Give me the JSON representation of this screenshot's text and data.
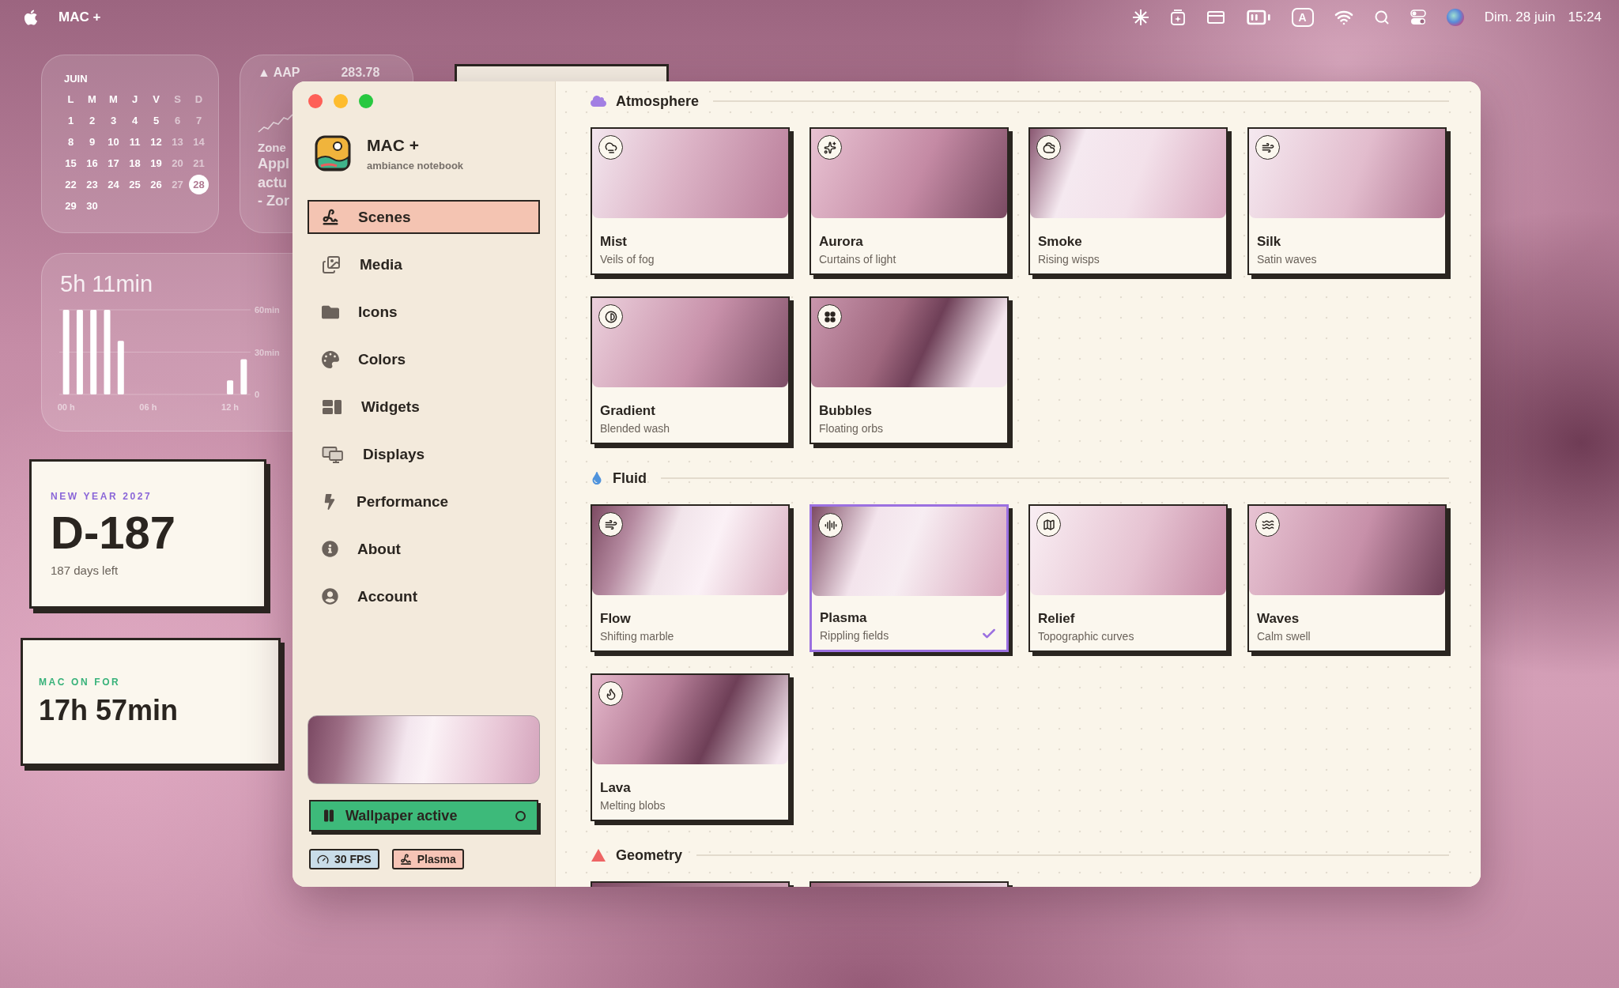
{
  "menu_bar": {
    "app_name": "MAC +",
    "input_source": "A",
    "date": "Dim. 28 juin",
    "time": "15:24"
  },
  "desktop": {
    "calendar": {
      "month": "JUIN",
      "weekdays": [
        "L",
        "M",
        "M",
        "J",
        "V",
        "S",
        "D"
      ],
      "days": [
        {
          "label": "1",
          "selected": false
        },
        {
          "label": "2",
          "selected": false
        },
        {
          "label": "3",
          "selected": false
        },
        {
          "label": "4",
          "selected": false
        },
        {
          "label": "5",
          "selected": false
        },
        {
          "label": "6",
          "selected": false
        },
        {
          "label": "7",
          "selected": false
        },
        {
          "label": "8",
          "selected": false
        },
        {
          "label": "9",
          "selected": false
        },
        {
          "label": "10",
          "selected": false
        },
        {
          "label": "11",
          "selected": false
        },
        {
          "label": "12",
          "selected": false
        },
        {
          "label": "13",
          "selected": false
        },
        {
          "label": "14",
          "selected": false
        },
        {
          "label": "15",
          "selected": false
        },
        {
          "label": "16",
          "selected": false
        },
        {
          "label": "17",
          "selected": false
        },
        {
          "label": "18",
          "selected": false
        },
        {
          "label": "19",
          "selected": false
        },
        {
          "label": "20",
          "selected": false
        },
        {
          "label": "21",
          "selected": false
        },
        {
          "label": "22",
          "selected": false
        },
        {
          "label": "23",
          "selected": false
        },
        {
          "label": "24",
          "selected": false
        },
        {
          "label": "25",
          "selected": false
        },
        {
          "label": "26",
          "selected": false
        },
        {
          "label": "27",
          "selected": false
        },
        {
          "label": "28",
          "selected": true
        },
        {
          "label": "29",
          "selected": false
        },
        {
          "label": "30",
          "selected": false
        }
      ]
    },
    "stocks": {
      "symbol": "▲ AAP",
      "price": "283.78",
      "lines": [
        "Zone",
        "Appl",
        "actu",
        "- Zor"
      ]
    },
    "screen_time": {
      "total": "5h 11min",
      "chart_data": {
        "type": "bar",
        "x": [
          0,
          1,
          2,
          3,
          4,
          5,
          6,
          7,
          8,
          9,
          10,
          11,
          12,
          13
        ],
        "values": [
          60,
          60,
          60,
          60,
          38,
          0,
          0,
          0,
          0,
          0,
          0,
          0,
          10,
          25
        ],
        "xlim": [
          -0.5,
          13.5
        ],
        "ylim": [
          0,
          60
        ],
        "xticks": [
          {
            "value": 0,
            "label": "00 h"
          },
          {
            "value": 6,
            "label": "06 h"
          },
          {
            "value": 12,
            "label": "12 h"
          }
        ],
        "yticks": [
          {
            "value": 0,
            "label": "0"
          },
          {
            "value": 30,
            "label": "30min"
          },
          {
            "value": 60,
            "label": "60min"
          }
        ]
      }
    },
    "countdown": {
      "label": "NEW YEAR 2027",
      "value": "D-187",
      "caption": "187 days left"
    },
    "uptime": {
      "label": "MAC ON FOR",
      "value": "17h 57min"
    }
  },
  "window": {
    "sidebar": {
      "app_name": "MAC +",
      "tagline": "ambiance notebook",
      "nav": [
        {
          "label": "Scenes",
          "selected": true
        },
        {
          "label": "Media",
          "selected": false
        },
        {
          "label": "Icons",
          "selected": false
        },
        {
          "label": "Colors",
          "selected": false
        },
        {
          "label": "Widgets",
          "selected": false
        },
        {
          "label": "Displays",
          "selected": false
        },
        {
          "label": "Performance",
          "selected": false
        },
        {
          "label": "About",
          "selected": false
        },
        {
          "label": "Account",
          "selected": false
        }
      ],
      "wallpaper_button": {
        "label": "Wallpaper active",
        "on": true
      },
      "chips": [
        {
          "label": "30 FPS",
          "color": "#c9dde9"
        },
        {
          "label": "Plasma",
          "color": "#f6c4b6"
        }
      ]
    },
    "sections": [
      {
        "title": "Atmosphere",
        "color": "#a27fe3",
        "cards": [
          {
            "kind": "scene",
            "title": "Mist",
            "subtitle": "Veils of fog",
            "selected": false
          },
          {
            "kind": "scene",
            "title": "Aurora",
            "subtitle": "Curtains of light",
            "selected": false
          },
          {
            "kind": "scene",
            "title": "Smoke",
            "subtitle": "Rising wisps",
            "selected": false
          },
          {
            "kind": "scene",
            "title": "Silk",
            "subtitle": "Satin waves",
            "selected": false
          },
          {
            "kind": "scene",
            "title": "Gradient",
            "subtitle": "Blended wash",
            "selected": false
          },
          {
            "kind": "scene",
            "title": "Bubbles",
            "subtitle": "Floating orbs",
            "selected": false
          }
        ]
      },
      {
        "title": "Fluid",
        "color": "#4f93dc",
        "cards": [
          {
            "kind": "scene",
            "title": "Flow",
            "subtitle": "Shifting marble",
            "selected": false
          },
          {
            "kind": "scene",
            "title": "Plasma",
            "subtitle": "Rippling fields",
            "selected": true
          },
          {
            "kind": "scene",
            "title": "Relief",
            "subtitle": "Topographic curves",
            "selected": false
          },
          {
            "kind": "scene",
            "title": "Waves",
            "subtitle": "Calm swell",
            "selected": false
          },
          {
            "kind": "scene",
            "title": "Lava",
            "subtitle": "Melting blobs",
            "selected": false
          }
        ]
      },
      {
        "title": "Geometry",
        "color": "#ee6464",
        "cards": [
          {
            "kind": "stub"
          },
          {
            "kind": "stub"
          }
        ]
      }
    ]
  }
}
